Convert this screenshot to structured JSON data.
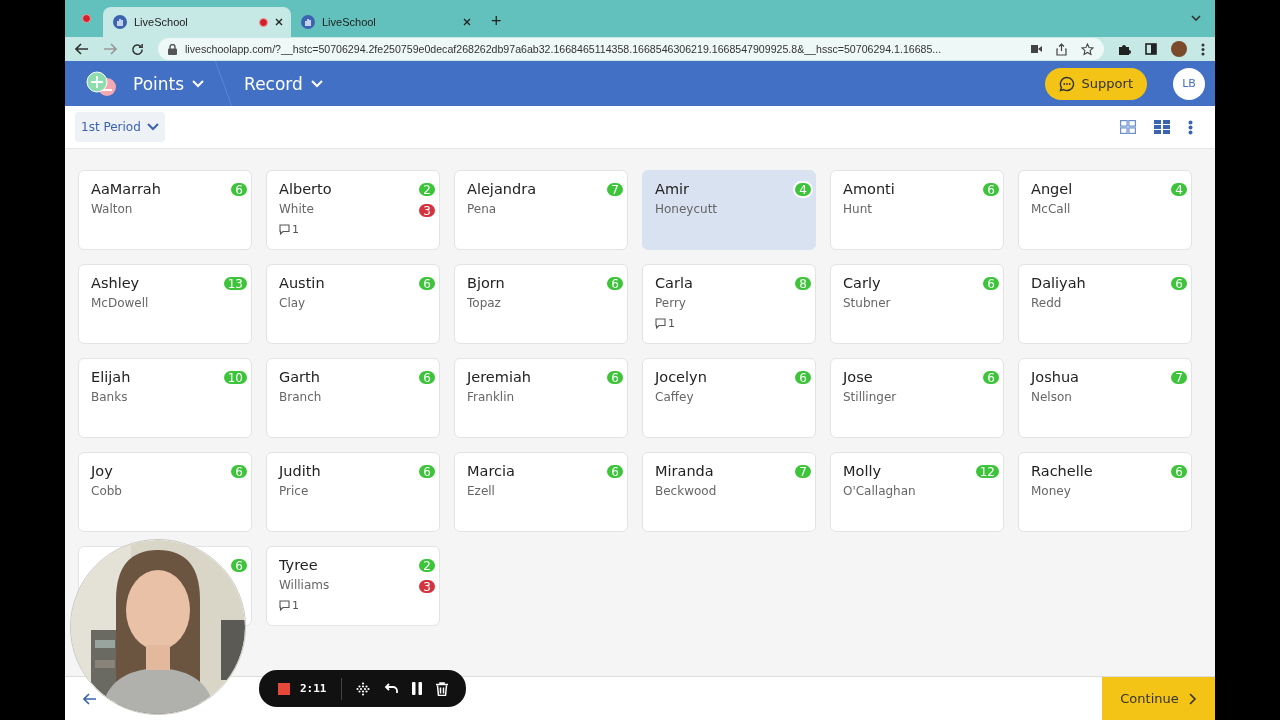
{
  "browser": {
    "tabs": [
      {
        "title": "LiveSchool",
        "selected": true,
        "recording": true
      },
      {
        "title": "LiveSchool",
        "selected": false,
        "recording": false
      }
    ],
    "new_tab": "+",
    "url": "liveschoolapp.com/?__hstc=50706294.2fe250759e0decaf268262db97a6ab32.1668465114358.1668546306219.1668547909925.8&__hssc=50706294.1.16685..."
  },
  "header": {
    "menus": [
      "Points",
      "Record"
    ],
    "support": "Support",
    "avatar": "LB"
  },
  "toolbar": {
    "period": "1st Period"
  },
  "students": [
    {
      "first": "AaMarrah",
      "last": "Walton",
      "points": "6",
      "selected": false
    },
    {
      "first": "Alberto",
      "last": "White",
      "points": "2",
      "minus": "3",
      "comments": "1",
      "selected": false
    },
    {
      "first": "Alejandra",
      "last": "Pena",
      "points": "7",
      "selected": false
    },
    {
      "first": "Amir",
      "last": "Honeycutt",
      "points": "4",
      "selected": true
    },
    {
      "first": "Amonti",
      "last": "Hunt",
      "points": "6",
      "selected": false
    },
    {
      "first": "Angel",
      "last": "McCall",
      "points": "4",
      "selected": false
    },
    {
      "first": "Ashley",
      "last": "McDowell",
      "points": "13",
      "selected": false
    },
    {
      "first": "Austin",
      "last": "Clay",
      "points": "6",
      "selected": false
    },
    {
      "first": "Bjorn",
      "last": "Topaz",
      "points": "6",
      "selected": false
    },
    {
      "first": "Carla",
      "last": "Perry",
      "points": "8",
      "comments": "1",
      "selected": false
    },
    {
      "first": "Carly",
      "last": "Stubner",
      "points": "6",
      "selected": false
    },
    {
      "first": "Daliyah",
      "last": "Redd",
      "points": "6",
      "selected": false
    },
    {
      "first": "Elijah",
      "last": "Banks",
      "points": "10",
      "selected": false
    },
    {
      "first": "Garth",
      "last": "Branch",
      "points": "6",
      "selected": false
    },
    {
      "first": "Jeremiah",
      "last": "Franklin",
      "points": "6",
      "selected": false
    },
    {
      "first": "Jocelyn",
      "last": "Caffey",
      "points": "6",
      "selected": false
    },
    {
      "first": "Jose",
      "last": "Stillinger",
      "points": "6",
      "selected": false
    },
    {
      "first": "Joshua",
      "last": "Nelson",
      "points": "7",
      "selected": false
    },
    {
      "first": "Joy",
      "last": "Cobb",
      "points": "6",
      "selected": false
    },
    {
      "first": "Judith",
      "last": "Price",
      "points": "6",
      "selected": false
    },
    {
      "first": "Marcia",
      "last": "Ezell",
      "points": "6",
      "selected": false
    },
    {
      "first": "Miranda",
      "last": "Beckwood",
      "points": "7",
      "selected": false
    },
    {
      "first": "Molly",
      "last": "O'Callaghan",
      "points": "12",
      "selected": false
    },
    {
      "first": "Rachelle",
      "last": "Money",
      "points": "6",
      "selected": false
    },
    {
      "points": "6",
      "selected": false
    },
    {
      "first": "Tyree",
      "last": "Williams",
      "points": "2",
      "minus": "3",
      "comments": "1",
      "selected": false
    }
  ],
  "footer": {
    "continue": "Continue"
  },
  "recorder": {
    "time": "2:11"
  }
}
